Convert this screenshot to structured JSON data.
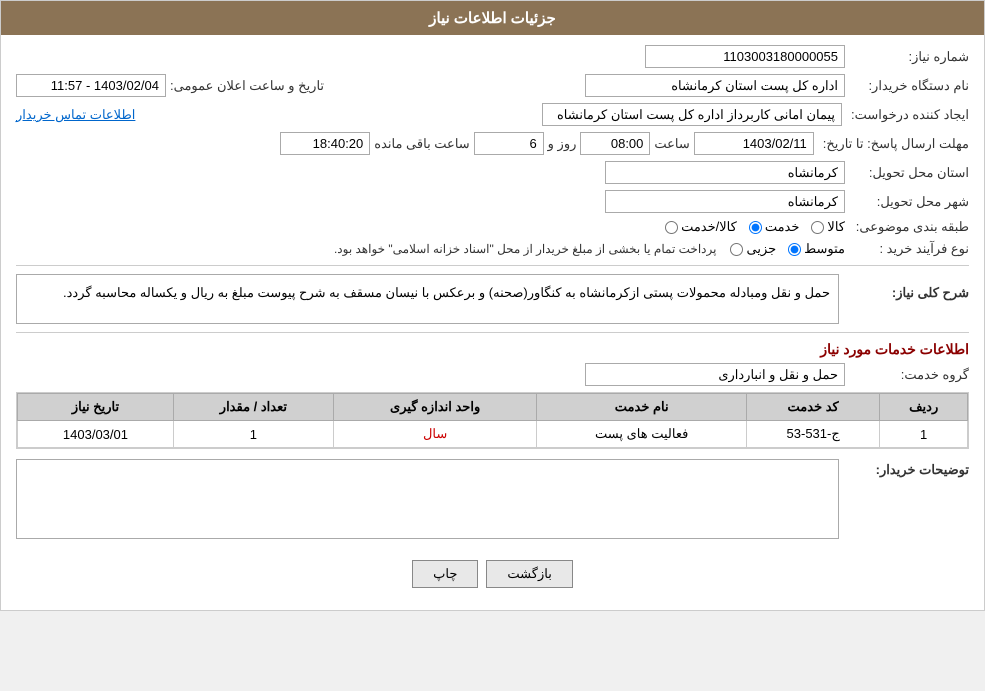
{
  "header": {
    "title": "جزئیات اطلاعات نیاز"
  },
  "form": {
    "shomara_niaz_label": "شماره نیاز:",
    "shomara_niaz_value": "1103003180000055",
    "nam_dastgah_label": "نام دستگاه خریدار:",
    "nam_dastgah_value": "اداره کل پست استان کرمانشاه",
    "tarikh_label": "تاریخ و ساعت اعلان عمومی:",
    "tarikh_value": "1403/02/04 - 11:57",
    "ijad_konande_label": "ایجاد کننده درخواست:",
    "ijad_konande_value": "پیمان امانی کاربرداز اداره کل پست استان کرمانشاه",
    "mohlat_label": "مهلت ارسال پاسخ: تا تاریخ:",
    "mohlat_date": "1403/02/11",
    "mohlat_saat_label": "ساعت",
    "mohlat_saat_value": "08:00",
    "mohlat_roz_label": "روز و",
    "mohlat_roz_value": "6",
    "mohlat_saat_mande_label": "ساعت باقی مانده",
    "mohlat_saat_mande_value": "18:40:20",
    "ostan_tahvil_label": "استان محل تحویل:",
    "ostan_tahvil_value": "کرمانشاه",
    "shahr_tahvil_label": "شهر محل تحویل:",
    "shahr_tahvil_value": "کرمانشاه",
    "tabaqe_label": "طبقه بندی موضوعی:",
    "tabaqe_options": [
      {
        "label": "کالا",
        "value": "kala"
      },
      {
        "label": "خدمت",
        "value": "khedmat"
      },
      {
        "label": "کالا/خدمت",
        "value": "kala_khedmat"
      }
    ],
    "tabaqe_selected": "khedmat",
    "nooe_farayand_label": "نوع فرآیند خرید :",
    "nooe_farayand_options": [
      {
        "label": "جزیی",
        "value": "jozi"
      },
      {
        "label": "متوسط",
        "value": "motevaset"
      }
    ],
    "nooe_farayand_note": "پرداخت تمام یا بخشی از مبلغ خریدار از محل \"اسناد خزانه اسلامی\" خواهد بود.",
    "nooe_farayand_selected": "motevaset",
    "etelasat_tamas_link": "اطلاعات تماس خریدار",
    "sharh_koli_label": "شرح کلی نیاز:",
    "sharh_koli_text": "حمل و نقل ومبادله محمولات پستی ازکرمانشاه به کنگاور(صحنه) و برعکس با نیسان مسقف به شرح پیوست مبلغ به ریال و یکساله محاسبه گردد.",
    "khadamat_label": "اطلاعات خدمات مورد نیاز",
    "gorohe_khedmat_label": "گروه خدمت:",
    "gorohe_khedmat_value": "حمل و نقل و انبارداری",
    "table": {
      "headers": [
        "ردیف",
        "کد خدمت",
        "نام خدمت",
        "واحد اندازه گیری",
        "تعداد / مقدار",
        "تاریخ نیاز"
      ],
      "rows": [
        {
          "radif": "1",
          "kod": "ج-531-53",
          "nam": "فعالیت های پست",
          "vahed": "سال",
          "tedad": "1",
          "tarikh": "1403/03/01"
        }
      ]
    },
    "tosif_kharidar_label": "توضیحات خریدار:",
    "buttons": {
      "back_label": "بازگشت",
      "print_label": "چاپ"
    }
  }
}
